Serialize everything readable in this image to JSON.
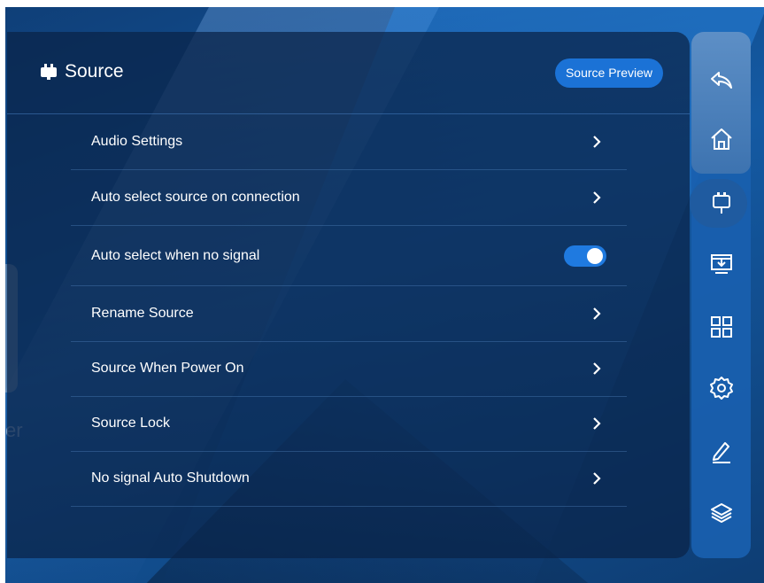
{
  "header": {
    "title": "Source",
    "preview_button": "Source Preview",
    "icon": "source-plug-icon"
  },
  "background": {
    "partial_text": "er"
  },
  "settings": [
    {
      "label": "Audio Settings",
      "control": "chevron"
    },
    {
      "label": "Auto select source on connection",
      "control": "chevron"
    },
    {
      "label": "Auto select when no signal",
      "control": "toggle",
      "value": true
    },
    {
      "label": "Rename Source",
      "control": "chevron"
    },
    {
      "label": "Source When Power On",
      "control": "chevron"
    },
    {
      "label": "Source Lock",
      "control": "chevron"
    },
    {
      "label": "No signal Auto Shutdown",
      "control": "chevron"
    }
  ],
  "sidebar": {
    "items": [
      {
        "icon": "back-icon",
        "active": false
      },
      {
        "icon": "home-icon",
        "active": false
      },
      {
        "icon": "source-icon",
        "active": true
      },
      {
        "icon": "screen-download-icon",
        "active": false
      },
      {
        "icon": "apps-grid-icon",
        "active": false
      },
      {
        "icon": "settings-gear-icon",
        "active": false
      },
      {
        "icon": "pen-icon",
        "active": false
      },
      {
        "icon": "layers-icon",
        "active": false
      }
    ]
  },
  "colors": {
    "accent": "#1b72d6",
    "panel": "#0a2246",
    "toggle_on": "#1f7ae0"
  }
}
